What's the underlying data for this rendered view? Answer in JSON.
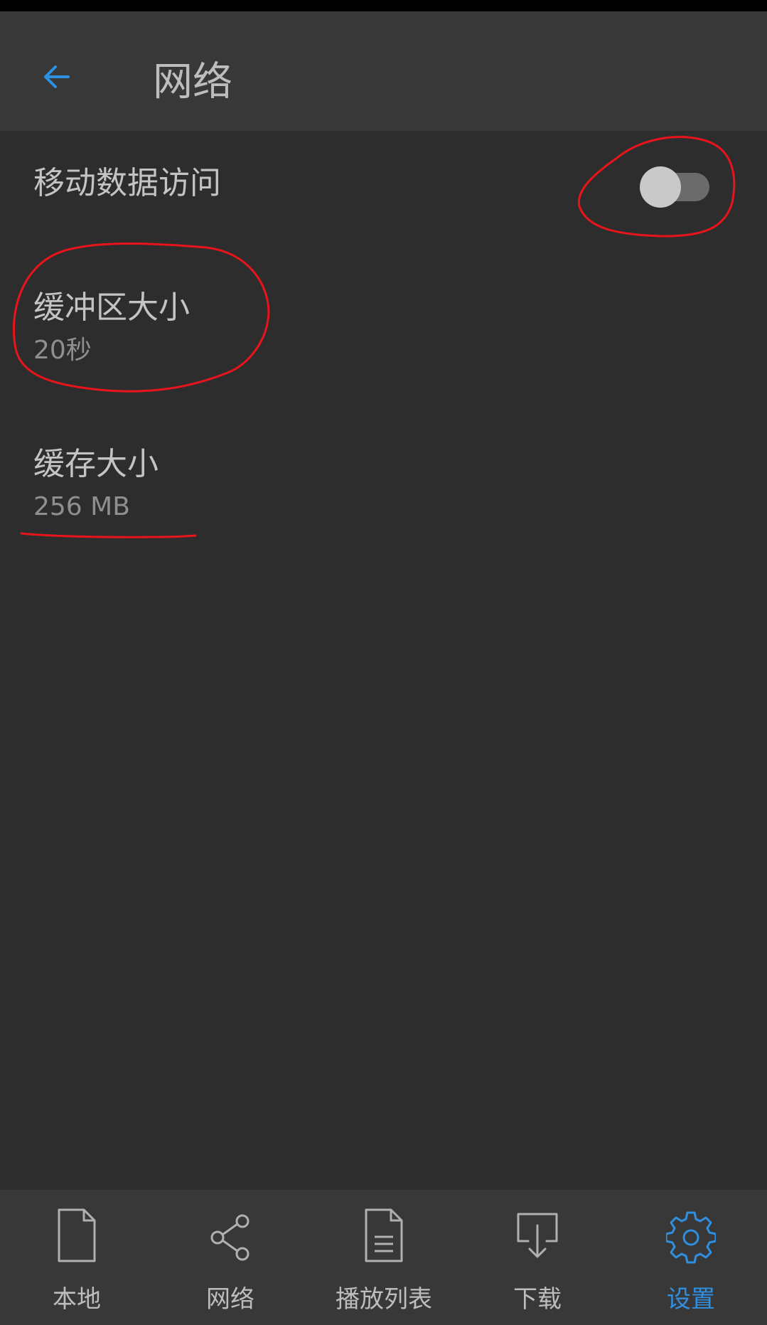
{
  "app_bar": {
    "back_icon": "arrow-left-icon",
    "title": "网络",
    "accent_color": "#2f8fe0"
  },
  "settings": {
    "mobile_data": {
      "label": "移动数据访问",
      "enabled": false
    },
    "buffer_size": {
      "label": "缓冲区大小",
      "value": "20秒"
    },
    "cache_size": {
      "label": "缓存大小",
      "value": "256 MB"
    }
  },
  "bottom_nav": {
    "items": [
      {
        "label": "本地",
        "icon": "file-icon",
        "active": false
      },
      {
        "label": "网络",
        "icon": "share-icon",
        "active": false
      },
      {
        "label": "播放列表",
        "icon": "list-document-icon",
        "active": false
      },
      {
        "label": "下载",
        "icon": "download-icon",
        "active": false
      },
      {
        "label": "设置",
        "icon": "gear-icon",
        "active": true
      }
    ]
  },
  "annotation_color": "#e8141c"
}
